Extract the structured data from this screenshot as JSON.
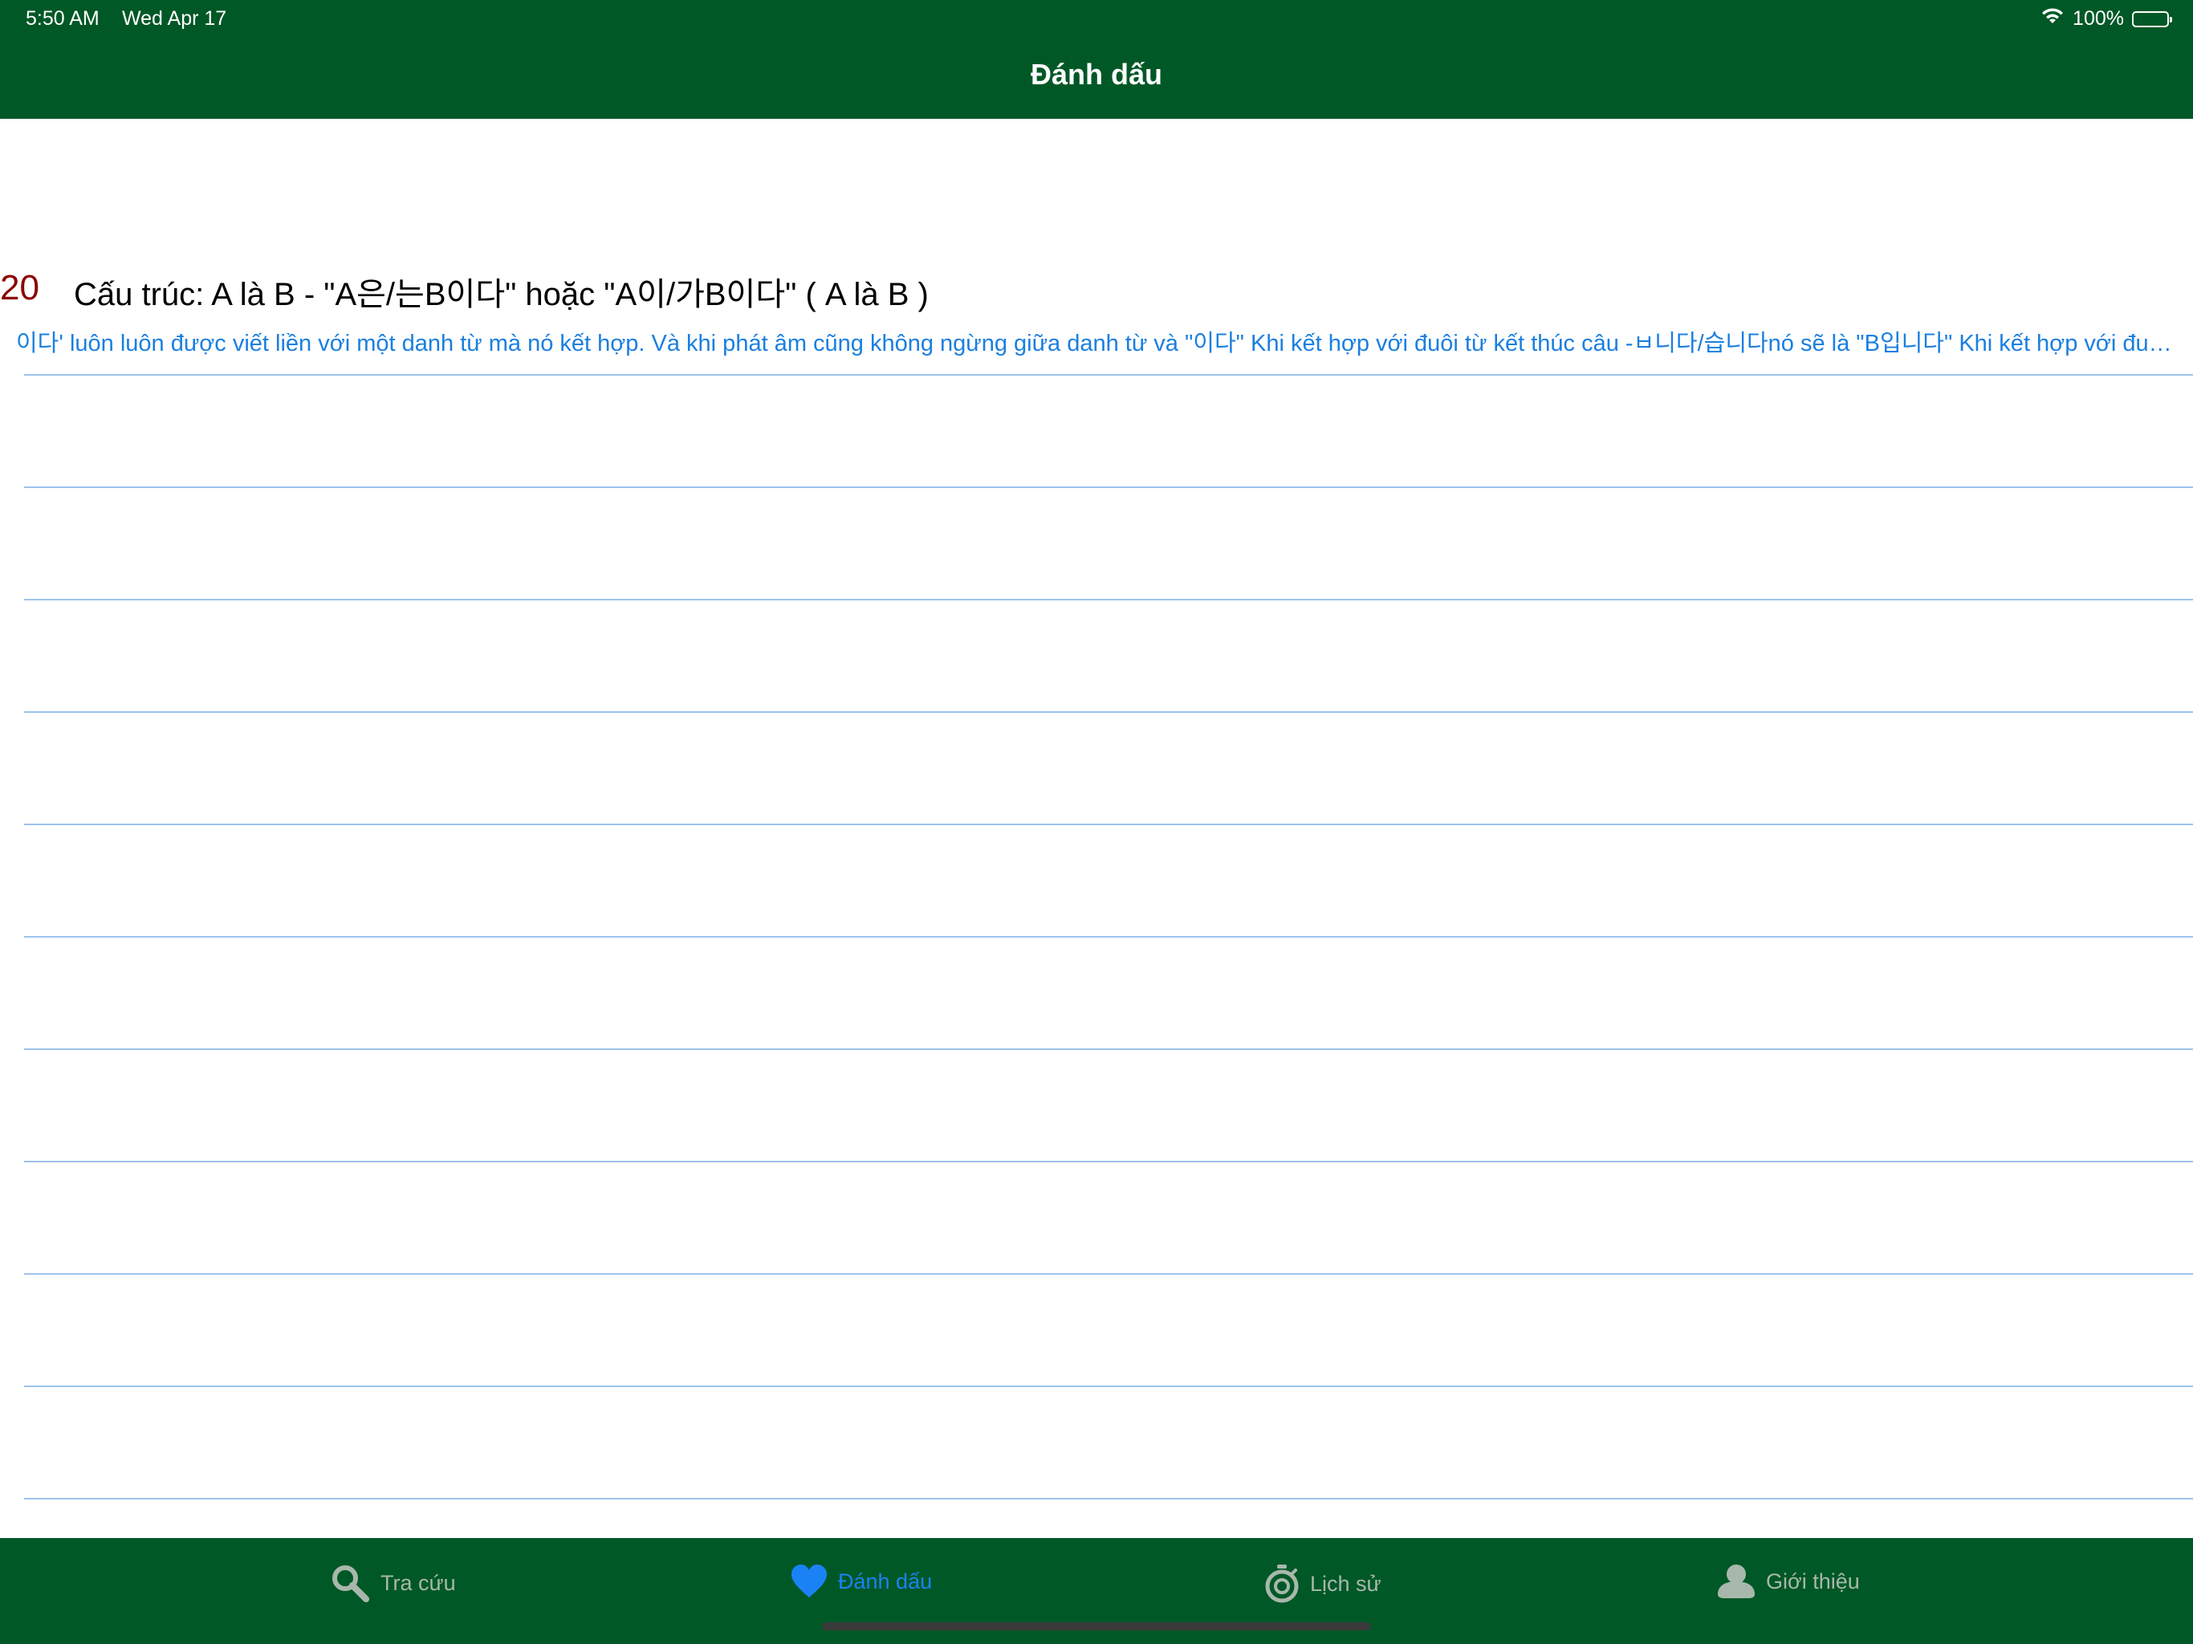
{
  "status_bar": {
    "time": "5:50 AM",
    "date": "Wed Apr 17",
    "battery": "100%",
    "battery_level": 1.0
  },
  "nav": {
    "title": "Đánh dấu"
  },
  "list": {
    "items": [
      {
        "number": "20",
        "title": "Cấu trúc: A là B - \"A은/는B이다\" hoặc \"A이/가B이다\" ( A là B )",
        "description": "이다' luôn luôn được viết liền với một danh từ mà nó kết hợp. Và khi phát âm cũng không ngừng giữa danh từ và \"이다\"  Khi kết hợp với đuôi từ kết thúc câu -ㅂ니다/습니다nó sẽ là \"B입니다\"  Khi kết hợp với đuôi từ kết thúc câu thân mật -아/어요 nó sẽ là B예요/이에요"
      }
    ]
  },
  "tabs": [
    {
      "label": "Tra cứu",
      "icon": "search-icon",
      "active": false
    },
    {
      "label": "Đánh dấu",
      "icon": "heart-icon",
      "active": true
    },
    {
      "label": "Lịch sử",
      "icon": "stopwatch-icon",
      "active": false
    },
    {
      "label": "Giới thiệu",
      "icon": "person-icon",
      "active": false
    }
  ],
  "colors": {
    "bar_green": "#005826",
    "active_tab": "#1a82f5",
    "inactive_tab": "#a8b7ac",
    "lesson_number": "#8b0000",
    "description": "#1a7fe0",
    "separator": "#9cc3ec"
  }
}
